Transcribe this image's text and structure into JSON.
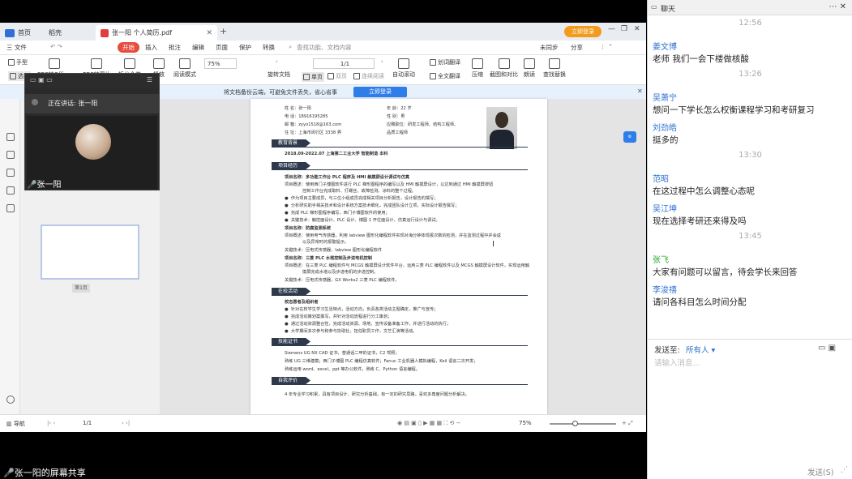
{
  "tabs": {
    "home": "首页",
    "doc": "张一阳 个人简历.pdf",
    "add": "+",
    "login": "立即登录"
  },
  "home_label": "稻壳",
  "menu": [
    "三 文件",
    "开始",
    "插入",
    "批注",
    "编辑",
    "页面",
    "保护",
    "转换"
  ],
  "search_placeholder": "查找功能、文档内容",
  "top_right": {
    "sync": "未同步",
    "share": "分享"
  },
  "toolbar": {
    "hand": "手型",
    "select": "选择",
    "pdf_office": "PDF转Office",
    "pdf_image": "PDF转图片",
    "split_merge": "拆分合并",
    "play": "播放",
    "read_mode": "阅读模式",
    "zoom": "75%",
    "page": "1/1",
    "rotate": "旋转文档",
    "single": "单页",
    "double": "双页",
    "continuous": "连续阅读",
    "auto_scroll": "自动滚动",
    "translate": "划词翻译",
    "full_translate": "全文翻译",
    "compress": "压缩",
    "compare": "截图和对比",
    "read_aloud": "朗读",
    "find_replace": "查找替换"
  },
  "notice": {
    "text": "将文档备份云端，可避免文件丢失，省心省事",
    "button": "立即登录"
  },
  "thumb_label": "第1页",
  "speaker": {
    "speaking": "正在讲话: 张一阳",
    "name": "张一阳"
  },
  "resume": {
    "name": "姓    名：张一阳",
    "phone": "电    话：18916195285",
    "email": "邮    箱：zyyo1518@163.com",
    "address": "住    址：上海市闵行区 3338 弄",
    "age": "年    龄：22 岁",
    "gender": "性    别：男",
    "job": "应聘职位：研发工程师、结构工程师、",
    "job2": "品质工程师",
    "sec_edu": "教育背景",
    "edu_line": "2018.09-2022.07          上海第二工业大学          智能制造          本科",
    "sec_project": "项目经历",
    "p1_title": "项目名称：多功能工作台 PLC 程序及 HMI 触摸屏设计调试与仿真",
    "p1_desc": "项目概述：使用西门子博图软件进行 PLC 梯形图程序的编写以及 HMI 触摸屏设计，以达到通过 HMI 触摸屏按钮",
    "p1_desc2": "控制工作台完成取料、打螺丝、故障检测、涂料的整个过程。",
    "p1_b1": "作为项目主要成员，与三位小组成员完成相关项目分析报告，设计报告的撰写；",
    "p1_b2": "分析研究助手相关技术和设计系统方案技术细化，完成团队设计立项，实际设计报告撰写；",
    "p1_b3": "完成 PLC 梯形图程序编写，西门子博图软件的使用；",
    "p1_b4": "关键技术：触控面设计、PLC 设计、博图 1 开位面设计、仿真运行设计与调试。",
    "p2_title": "项目名称：防腐监测系统",
    "p2_desc": "项目概述：使用电气传感器，利用 labview 图形化编程软件实现对海分钟体现报次数的检测，并在监测过程中并会返",
    "p2_desc2": "以及异常时的报警提示。",
    "p2_tech": "关键技术：压电式传感器，labview 图形化编程软件",
    "p3_title": "项目名称：三菱 PLC 水塔控制及步进电机控制",
    "p3_desc": "项目概述：在三菱 PLC 编程软件与 MCGS 触摸屏设计软件平台，运用三菱 PLC 编程软件以及 MCGS 触摸屏设计软件，实现运用触",
    "p3_desc2": "摸屏完成水塔以及步进电机的步进控制。",
    "p3_tech": "关键技术：压电式传感器，GX Works2 三菱 PLC 编程软件。",
    "sec_campus": "在校活动",
    "c_title": "校志愿者及组织者",
    "c_b1": "针对在校学生学习生活特点，活动方向，负责各类活动主题确定，推广与宣传；",
    "c_b2": "完成活动策划案撰写，并针对活动流程进行分工策划；",
    "c_b3": "通过活动资源整合性，完成活动资源、场地、宣传设备准备工作，并进行活动的执行；",
    "c_b4": "大学期间多次参与和参与协助社，担任职员工作，文艺汇演等活动。",
    "sec_skills": "技能证书",
    "s1": "Siemens UG NX CAD 证书，普通话二甲的证书，C2 驾照；",
    "s2": "熟练 UG 三维建模；西门子博图 PLC 编程仿真软件；Fanuc 工业机器人模拟编程，Keil 语言二次开发；",
    "s3": "熟练运用 word、excel、ppt 等办公软件，熟练 C、Python 语言编程。",
    "sec_self": "自我评价",
    "e1": "4 年专业学习积累，具有项目设计、研究分析基础，有一定的研究思路，喜欢多角度问题分析解决。"
  },
  "status": {
    "nav": "导航",
    "page": "1/1",
    "zoom": "75%"
  },
  "share_text": "张一阳的屏幕共享",
  "chat": {
    "title": "聊天",
    "messages": [
      {
        "time": "12:56"
      },
      {
        "sender": "姜文博",
        "sender_color": "#2f6fd6",
        "text": "老师 我们一会下楼做核酸"
      },
      {
        "time": "13:26"
      },
      {
        "sender": "吴萧宁",
        "sender_color": "#2f6fd6",
        "text": "想问一下学长怎么权衡课程学习和考研复习"
      },
      {
        "sender": "刘劲皓",
        "sender_color": "#2f6fd6",
        "text": "挺多的"
      },
      {
        "time": "13:30"
      },
      {
        "sender": "范昭",
        "sender_color": "#2f6fd6",
        "text": "在这过程中怎么调整心态呢"
      },
      {
        "sender": "吴江坤",
        "sender_color": "#2f6fd6",
        "text": "现在选择考研还来得及吗"
      },
      {
        "time": "13:45"
      },
      {
        "sender": "张飞",
        "sender_color": "#2aa52a",
        "text": "大家有问题可以留言，待会学长来回答"
      },
      {
        "sender": "李浚禧",
        "sender_color": "#2f6fd6",
        "text": "请问各科目怎么时间分配"
      }
    ],
    "send_to_label": "发送至:",
    "send_to_target": "所有人 ▾",
    "input_placeholder": "请输入消息...",
    "send_button": "发送(S)"
  }
}
